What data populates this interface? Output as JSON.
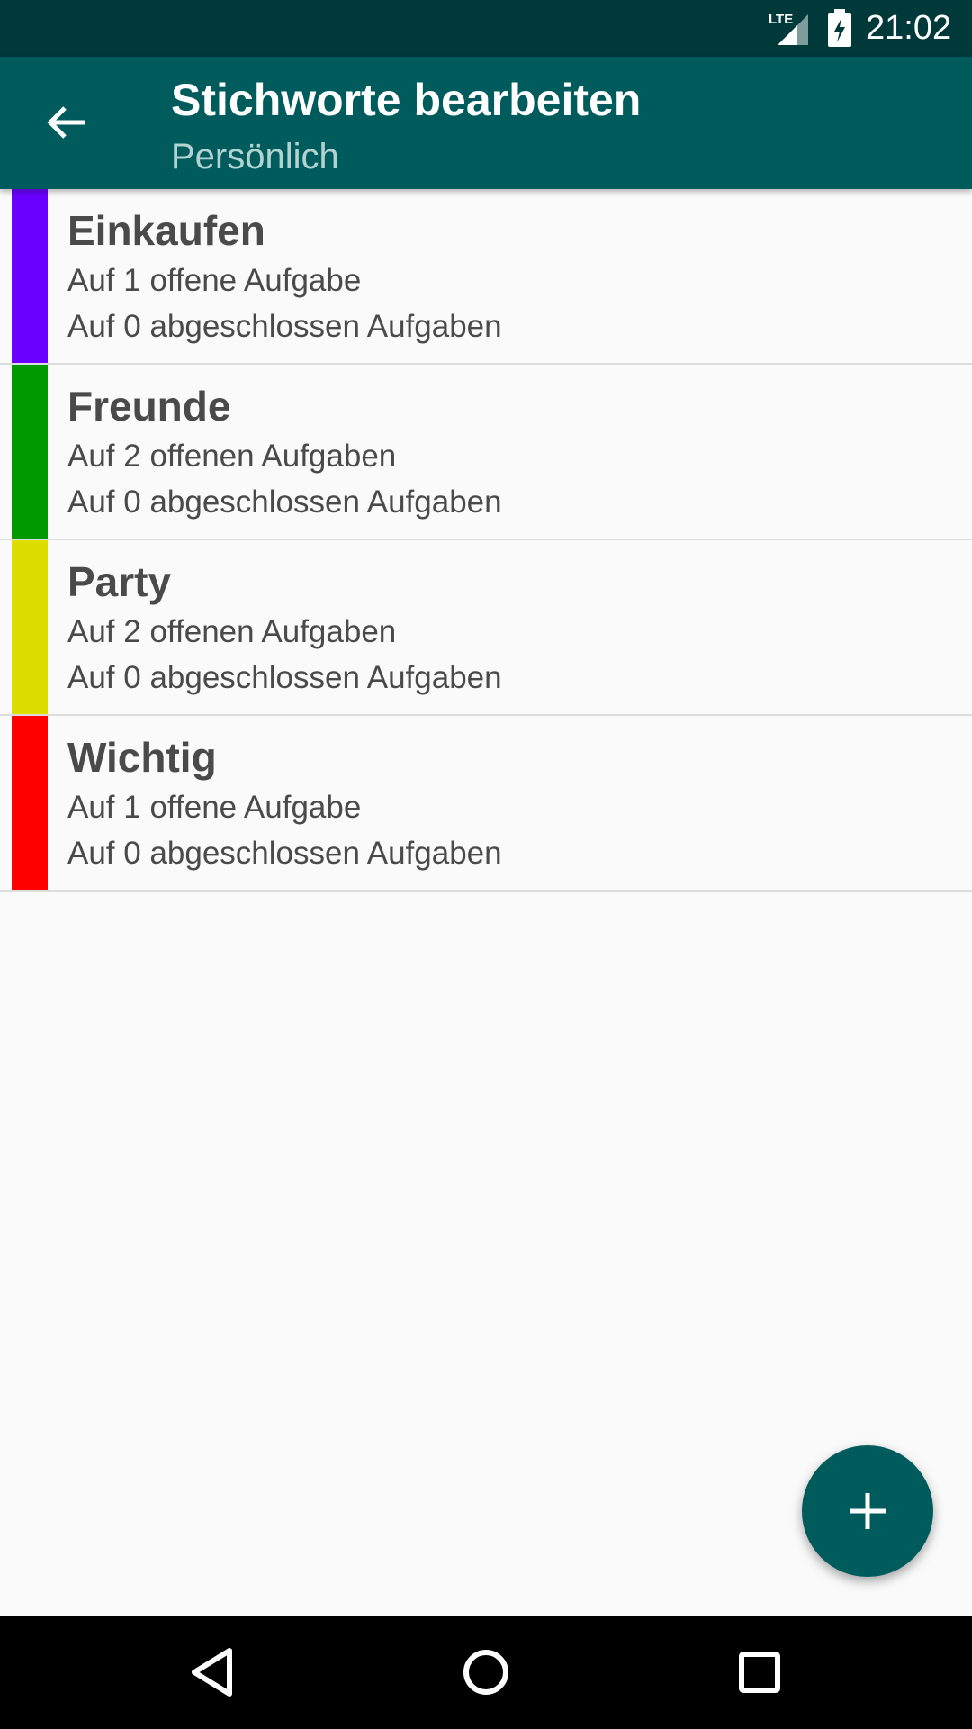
{
  "status_bar": {
    "network_label": "LTE",
    "time": "21:02",
    "signal_icon": "lte-signal-icon",
    "battery_icon": "battery-charging-icon"
  },
  "app_bar": {
    "back_icon": "arrow-back-icon",
    "title": "Stichworte bearbeiten",
    "subtitle": "Persönlich"
  },
  "tags": [
    {
      "name": "Einkaufen",
      "open_text": "Auf 1 offene Aufgabe",
      "done_text": "Auf 0 abgeschlossen Aufgaben",
      "color": "#6a00ff"
    },
    {
      "name": "Freunde",
      "open_text": "Auf 2 offenen Aufgaben",
      "done_text": "Auf 0 abgeschlossen Aufgaben",
      "color": "#009900"
    },
    {
      "name": "Party",
      "open_text": "Auf 2 offenen Aufgaben",
      "done_text": "Auf 0 abgeschlossen Aufgaben",
      "color": "#dddd00"
    },
    {
      "name": "Wichtig",
      "open_text": "Auf 1 offene Aufgabe",
      "done_text": "Auf 0 abgeschlossen Aufgaben",
      "color": "#ff0000"
    }
  ],
  "fab": {
    "icon": "plus-icon"
  },
  "nav_bar": {
    "back_icon": "nav-back-triangle-icon",
    "home_icon": "nav-home-circle-icon",
    "recents_icon": "nav-recents-square-icon"
  },
  "colors": {
    "status_bar": "#00393a",
    "app_bar": "#005c5c",
    "subtitle": "#b3d3d3",
    "background": "#fafafa",
    "text": "#4a4a4a"
  }
}
